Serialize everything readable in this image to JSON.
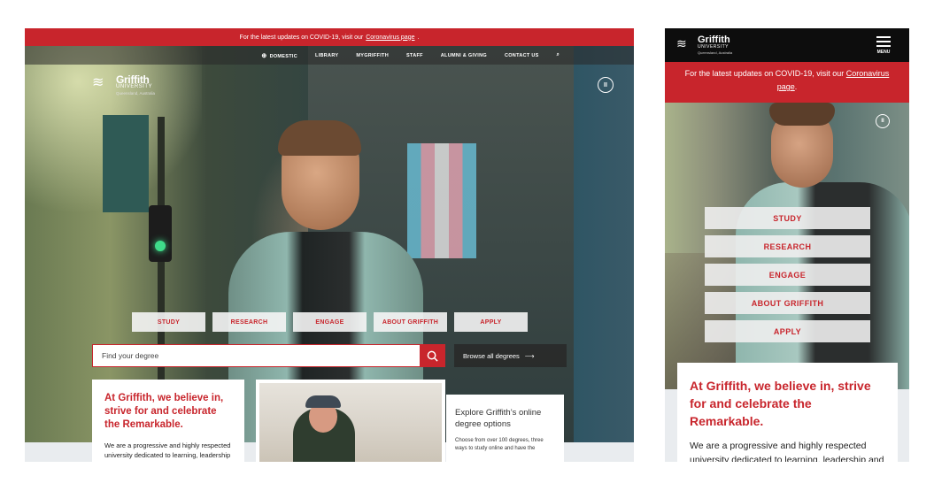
{
  "desktop": {
    "covid": {
      "text": "For the latest updates on COVID-19, visit our",
      "link": "Coronavirus page",
      "end": "."
    },
    "nav": {
      "items": [
        "DOMESTIC",
        "LIBRARY",
        "MYGRIFFITH",
        "STAFF",
        "ALUMNI & GIVING",
        "CONTACT US"
      ],
      "globe_glyph": "⊕",
      "search_glyph": "⌕"
    },
    "logo": {
      "name": "Griffith",
      "sub": "UNIVERSITY",
      "tagline": "Queensland, Australia",
      "mark": "≋"
    },
    "pause_glyph": "II",
    "buttons": [
      "STUDY",
      "RESEARCH",
      "ENGAGE",
      "ABOUT GRIFFITH",
      "APPLY"
    ],
    "search": {
      "placeholder": "Find your degree"
    },
    "browse": {
      "label": "Browse all degrees",
      "arrow": "⟶"
    },
    "card1": {
      "heading": "At Griffith, we believe in, strive for and celebrate the Remarkable.",
      "body": "We are a progressive and highly respected university dedicated to learning, leadership"
    },
    "card3": {
      "heading": "Explore Griffith’s online degree options",
      "body": "Choose from over 100 degrees, three ways to study online and have the"
    }
  },
  "mobile": {
    "logo": {
      "name": "Griffith",
      "sub": "UNIVERSITY",
      "tagline": "Queensland, Australia",
      "mark": "≋"
    },
    "menu_label": "MENU",
    "covid": {
      "text": "For the latest updates on COVID-19, visit our",
      "link": "Coronavirus page",
      "end": "."
    },
    "pause_glyph": "II",
    "buttons": [
      "STUDY",
      "RESEARCH",
      "ENGAGE",
      "ABOUT GRIFFITH",
      "APPLY"
    ],
    "card": {
      "heading": "At Griffith, we believe in, strive for and celebrate the Remarkable.",
      "body": "We are a progressive and highly respected university dedicated to learning, leadership and"
    }
  },
  "colors": {
    "brand_red": "#c8252c",
    "dark": "#0d0d0d"
  }
}
